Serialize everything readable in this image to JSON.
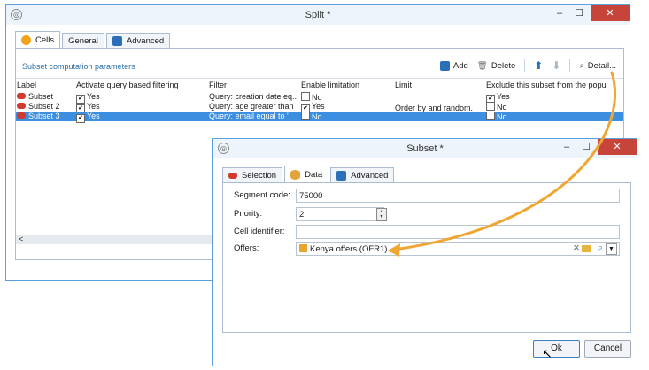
{
  "split_window": {
    "title": "Split *",
    "app_icon": "split-app-icon",
    "tabs": [
      {
        "label": "Cells",
        "icon": "cells-icon"
      },
      {
        "label": "General",
        "icon": ""
      },
      {
        "label": "Advanced",
        "icon": "advanced-icon"
      }
    ],
    "section_title": "Subset computation parameters",
    "toolbar": {
      "add": "Add",
      "delete": "Delete",
      "detail": "Detail..."
    },
    "columns": [
      "Label",
      "Activate query based filtering",
      "Filter",
      "Enable limitation",
      "Limit",
      "Exclude this subset from the popul"
    ],
    "rows": [
      {
        "label": "Subset",
        "activate": "Yes",
        "filter": "Query: creation date eq...",
        "limitation": "No",
        "limit": "",
        "exclude": "Yes"
      },
      {
        "label": "Subset 2",
        "activate": "Yes",
        "filter": "Query: age greater than",
        "limitation": "Yes",
        "limit": "Order by  and random.",
        "exclude": "No"
      },
      {
        "label": "Subset 3",
        "activate": "Yes",
        "filter": "Query: email equal to '",
        "limitation": "No",
        "limit": "",
        "exclude": "No"
      }
    ],
    "scroll_left_glyph": "<"
  },
  "subset_window": {
    "title": "Subset *",
    "tabs": [
      {
        "label": "Selection",
        "icon": "selection-icon"
      },
      {
        "label": "Data",
        "icon": "data-icon"
      },
      {
        "label": "Advanced",
        "icon": "advanced-icon"
      }
    ],
    "fields": {
      "segment_code": {
        "label": "Segment code:",
        "value": "75000"
      },
      "priority": {
        "label": "Priority:",
        "value": "2"
      },
      "cell_identifier": {
        "label": "Cell identifier:",
        "value": ""
      },
      "offers": {
        "label": "Offers:",
        "value": "Kenya offers (OFR1)"
      }
    },
    "ok": "Ok",
    "cancel": "Cancel"
  },
  "colors": {
    "accent": "#3b8ee0",
    "arrow": "#f0a632",
    "close": "#c7443a"
  }
}
